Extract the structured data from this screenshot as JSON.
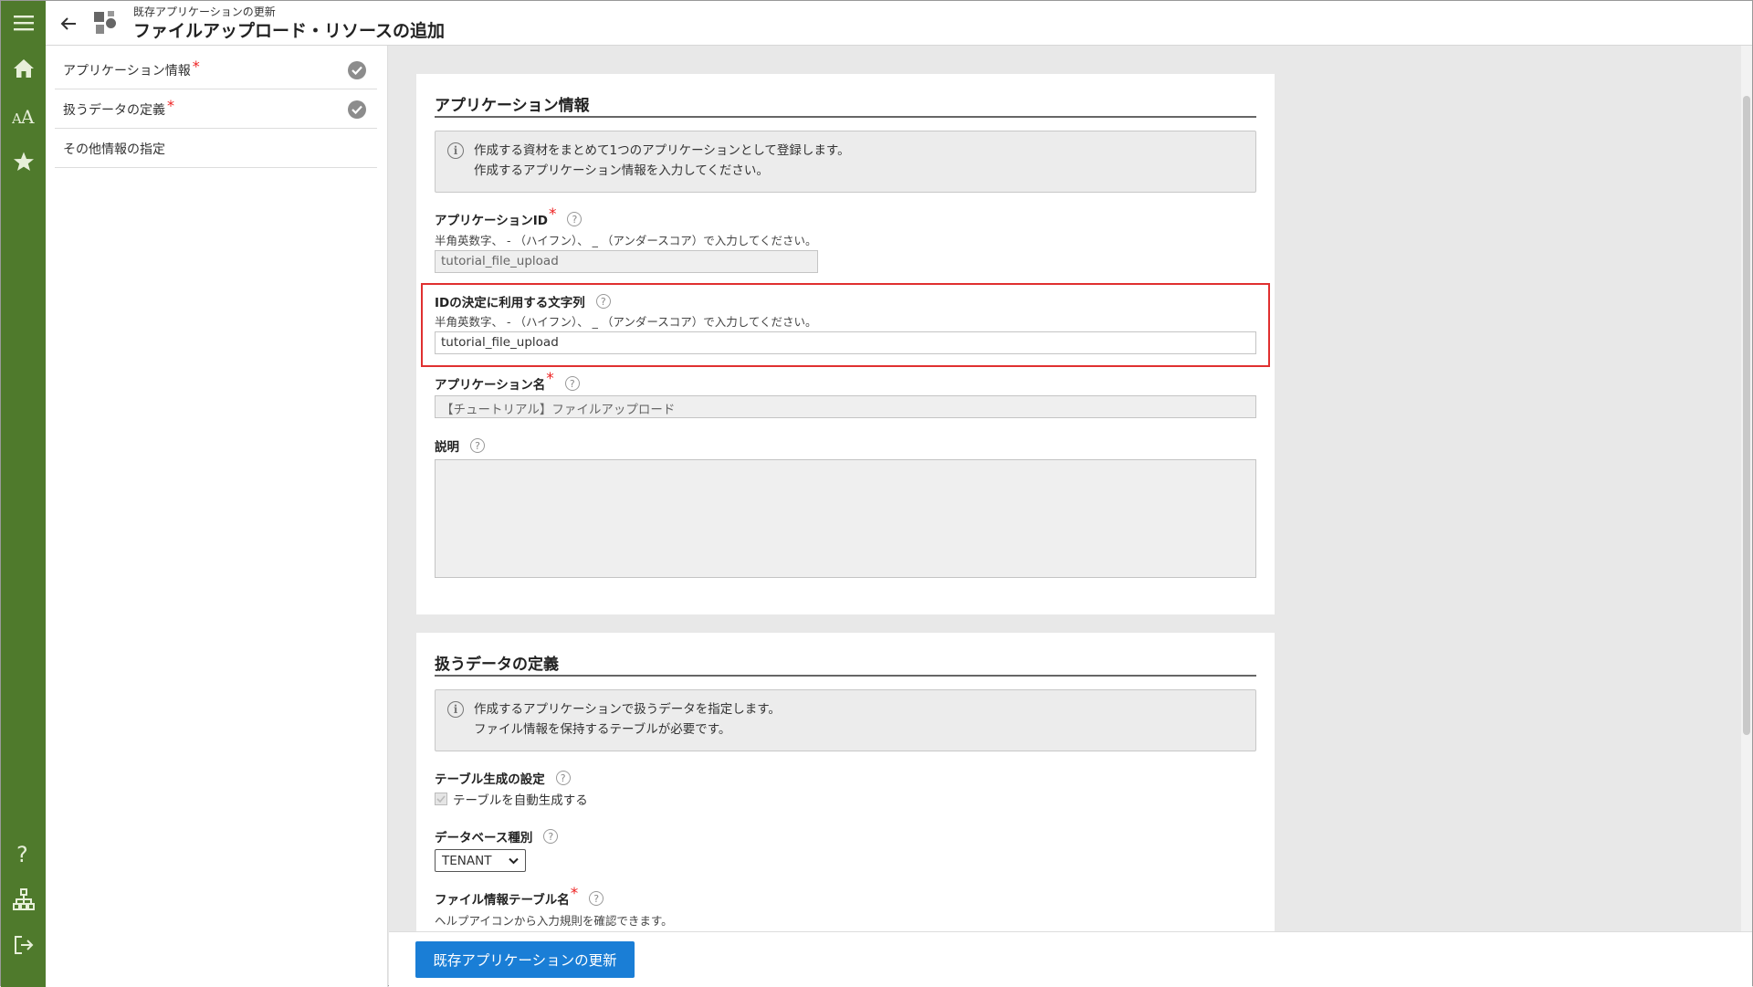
{
  "header": {
    "subtitle": "既存アプリケーションの更新",
    "title": "ファイルアップロード・リソースの追加"
  },
  "rail_icons": [
    "menu-icon",
    "home-icon",
    "font-icon",
    "star-icon",
    "help-icon",
    "sitemap-icon",
    "logout-icon"
  ],
  "sidenav": {
    "items": [
      {
        "label": "アプリケーション情報",
        "required": "*",
        "completed": true
      },
      {
        "label": "扱うデータの定義",
        "required": "*",
        "completed": true
      },
      {
        "label": "その他情報の指定",
        "completed": false
      }
    ]
  },
  "app_info": {
    "title": "アプリケーション情報",
    "info_line1": "作成する資材をまとめて1つのアプリケーションとして登録します。",
    "info_line2": "作成するアプリケーション情報を入力してください。",
    "app_id_label": "アプリケーションID",
    "app_id_hint": "半角英数字、 - （ハイフン）、 _ （アンダースコア）で入力してください。",
    "app_id_value": "tutorial_file_upload",
    "id_string_label": "IDの決定に利用する文字列",
    "id_string_hint": "半角英数字、 - （ハイフン）、 _ （アンダースコア）で入力してください。",
    "id_string_value": "tutorial_file_upload",
    "app_name_label": "アプリケーション名",
    "app_name_value": "【チュートリアル】ファイルアップロード",
    "description_label": "説明",
    "required_mark": "*",
    "help_mark": "?"
  },
  "data_def": {
    "title": "扱うデータの定義",
    "info_line1": "作成するアプリケーションで扱うデータを指定します。",
    "info_line2": "ファイル情報を保持するテーブルが必要です。",
    "table_gen_label": "テーブル生成の設定",
    "auto_gen_label": "テーブルを自動生成する",
    "db_type_label": "データベース種別",
    "db_type_value": "TENANT",
    "file_table_label": "ファイル情報テーブル名",
    "file_table_hint": "ヘルプアイコンから入力規則を確認できます。"
  },
  "footer": {
    "submit_label": "既存アプリケーションの更新"
  },
  "colors": {
    "rail": "#4f7a2c",
    "primary": "#1a7ed6",
    "highlight": "#e03030",
    "required": "#e22222"
  }
}
